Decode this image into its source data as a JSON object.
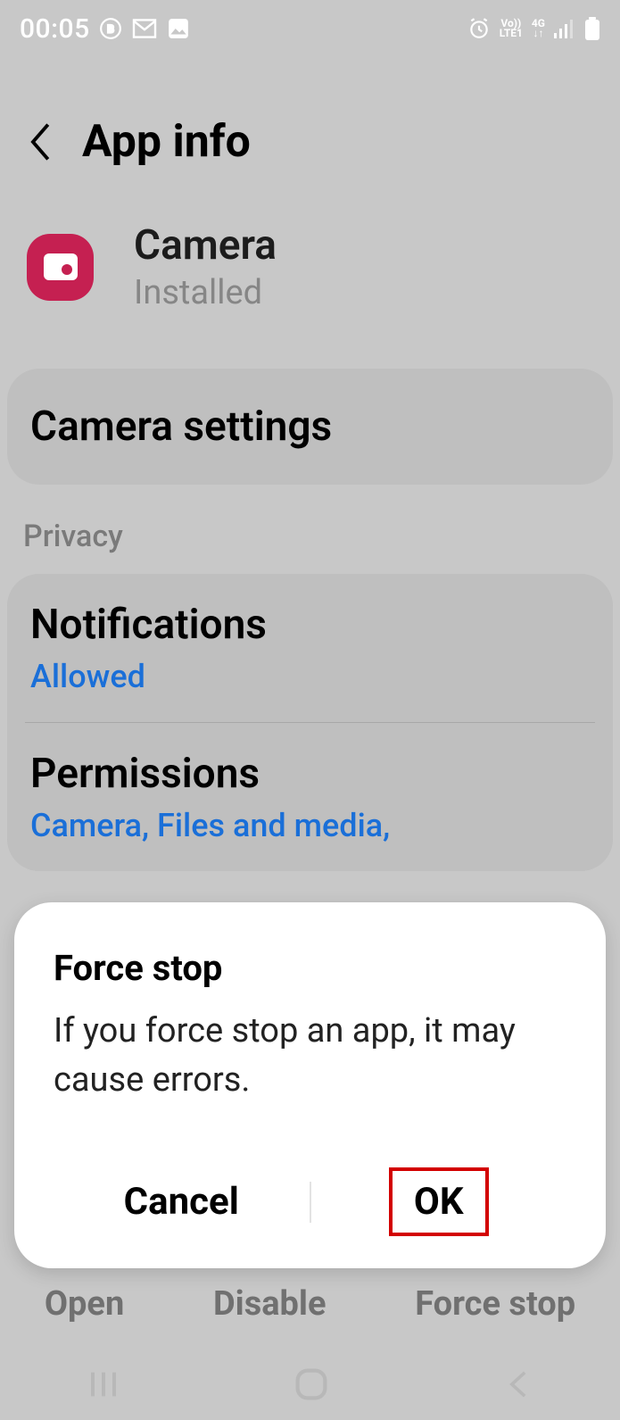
{
  "statusbar": {
    "time": "00:05",
    "network_label_top": "Vo))",
    "network_label_bottom": "LTE1",
    "network_gen": "4G"
  },
  "header": {
    "title": "App info"
  },
  "app": {
    "name": "Camera",
    "status": "Installed"
  },
  "settings": {
    "label": "Camera settings"
  },
  "sections": {
    "privacy": "Privacy"
  },
  "notifications": {
    "title": "Notifications",
    "value": "Allowed"
  },
  "permissions": {
    "title": "Permissions",
    "value": "Camera, Files and media,"
  },
  "bottom_actions": {
    "open": "Open",
    "disable": "Disable",
    "force_stop": "Force stop"
  },
  "dialog": {
    "title": "Force stop",
    "message": "If you force stop an app, it may cause errors.",
    "cancel": "Cancel",
    "ok": "OK"
  }
}
